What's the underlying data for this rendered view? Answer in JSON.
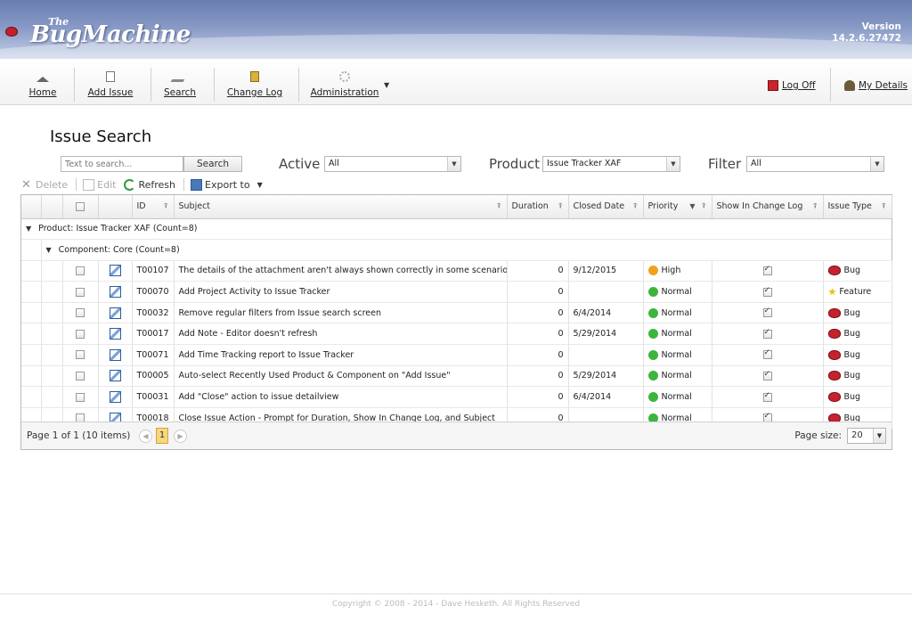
{
  "header": {
    "logo_the": "The",
    "logo_name": "BugMachine",
    "version_label": "Version",
    "version_number": "14.2.6.27472"
  },
  "nav": {
    "home": "Home",
    "add_issue": "Add Issue",
    "search": "Search",
    "change_log": "Change Log",
    "administration": "Administration",
    "log_off": "Log Off",
    "my_details": "My Details"
  },
  "page": {
    "title": "Issue Search"
  },
  "search": {
    "placeholder": "Text to search...",
    "button_label": "Search",
    "active_label": "Active",
    "active_value": "All",
    "product_label": "Product",
    "product_value": "Issue Tracker XAF",
    "filter_label": "Filter",
    "filter_value": "All"
  },
  "toolbar": {
    "delete": "Delete",
    "edit": "Edit",
    "refresh": "Refresh",
    "export": "Export to"
  },
  "grid": {
    "columns": {
      "id": "ID",
      "subject": "Subject",
      "duration": "Duration",
      "closed_date": "Closed Date",
      "priority": "Priority",
      "show_in_change_log": "Show In Change Log",
      "issue_type": "Issue Type"
    },
    "group_product": "Product: Issue Tracker XAF (Count=8)",
    "group_component": "Component: Core (Count=8)",
    "rows": [
      {
        "id": "T00107",
        "subject": "The details of the attachment aren't always shown correctly in some scenarios",
        "duration": "0",
        "closed": "9/12/2015",
        "priority": "High",
        "type": "Bug"
      },
      {
        "id": "T00070",
        "subject": "Add Project Activity to Issue Tracker",
        "duration": "0",
        "closed": "",
        "priority": "Normal",
        "type": "Feature"
      },
      {
        "id": "T00032",
        "subject": "Remove regular filters from Issue search screen",
        "duration": "0",
        "closed": "6/4/2014",
        "priority": "Normal",
        "type": "Bug"
      },
      {
        "id": "T00017",
        "subject": "Add Note - Editor doesn't refresh",
        "duration": "0",
        "closed": "5/29/2014",
        "priority": "Normal",
        "type": "Bug"
      },
      {
        "id": "T00071",
        "subject": "Add Time Tracking report to Issue Tracker",
        "duration": "0",
        "closed": "",
        "priority": "Normal",
        "type": "Bug"
      },
      {
        "id": "T00005",
        "subject": "Auto-select Recently Used Product & Component on \"Add Issue\"",
        "duration": "0",
        "closed": "5/29/2014",
        "priority": "Normal",
        "type": "Bug"
      },
      {
        "id": "T00031",
        "subject": "Add \"Close\" action to issue detailview",
        "duration": "0",
        "closed": "6/4/2014",
        "priority": "Normal",
        "type": "Bug"
      },
      {
        "id": "T00018",
        "subject": "Close Issue Action - Prompt for Duration, Show In Change Log, and Subject",
        "duration": "0",
        "closed": "",
        "priority": "Normal",
        "type": "Bug"
      }
    ]
  },
  "pager": {
    "info": "Page 1 of 1 (10 items)",
    "current_page": "1",
    "page_size_label": "Page size:",
    "page_size": "20"
  },
  "footer": {
    "copyright": "Copyright © 2008 - 2014 - Dave Hesketh. All Rights Reserved"
  },
  "colors": {
    "priority_high": "#f0a21e",
    "priority_normal": "#3db43d",
    "bug": "#c4232d"
  }
}
